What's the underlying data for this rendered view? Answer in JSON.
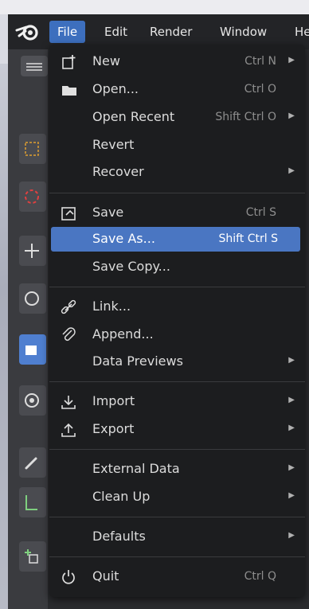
{
  "menubar": {
    "items": [
      "File",
      "Edit",
      "Render",
      "Window",
      "He"
    ],
    "active": "File"
  },
  "file_menu": {
    "items": [
      {
        "label": "New",
        "shortcut": "Ctrl N",
        "submenu": true,
        "icon": "new-file-icon"
      },
      {
        "label": "Open...",
        "shortcut": "Ctrl O",
        "submenu": false,
        "icon": "folder-icon"
      },
      {
        "label": "Open Recent",
        "shortcut": "Shift Ctrl O",
        "submenu": true,
        "icon": ""
      },
      {
        "label": "Revert",
        "shortcut": "",
        "submenu": false,
        "icon": ""
      },
      {
        "label": "Recover",
        "shortcut": "",
        "submenu": true,
        "icon": ""
      },
      {
        "label": "Save",
        "shortcut": "Ctrl S",
        "submenu": false,
        "icon": "save-icon"
      },
      {
        "label": "Save As...",
        "shortcut": "Shift Ctrl S",
        "submenu": false,
        "icon": "",
        "selected": true
      },
      {
        "label": "Save Copy...",
        "shortcut": "",
        "submenu": false,
        "icon": ""
      },
      {
        "label": "Link...",
        "shortcut": "",
        "submenu": false,
        "icon": "link-icon"
      },
      {
        "label": "Append...",
        "shortcut": "",
        "submenu": false,
        "icon": "paperclip-icon"
      },
      {
        "label": "Data Previews",
        "shortcut": "",
        "submenu": true,
        "icon": ""
      },
      {
        "label": "Import",
        "shortcut": "",
        "submenu": true,
        "icon": "import-icon"
      },
      {
        "label": "Export",
        "shortcut": "",
        "submenu": true,
        "icon": "export-icon"
      },
      {
        "label": "External Data",
        "shortcut": "",
        "submenu": true,
        "icon": ""
      },
      {
        "label": "Clean Up",
        "shortcut": "",
        "submenu": true,
        "icon": ""
      },
      {
        "label": "Defaults",
        "shortcut": "",
        "submenu": true,
        "icon": ""
      },
      {
        "label": "Quit",
        "shortcut": "Ctrl Q",
        "submenu": false,
        "icon": "power-icon"
      }
    ]
  },
  "colors": {
    "highlight": "#4a76c2",
    "menu_bg": "#1c1d1f",
    "active_tab": "#3d6fbe"
  }
}
